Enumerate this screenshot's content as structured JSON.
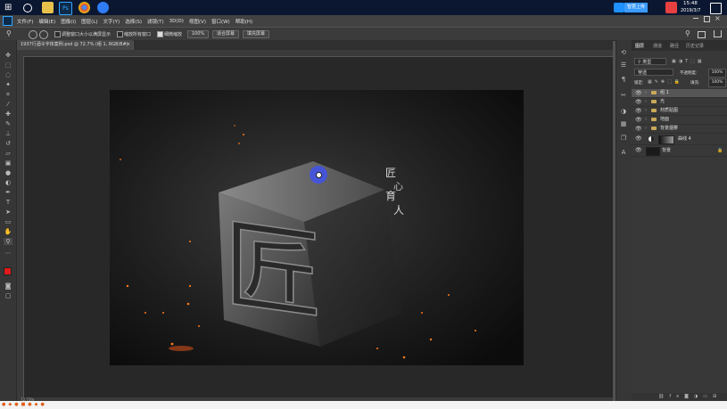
{
  "taskbar": {
    "time": "15:48",
    "date": "2019/3/7",
    "upload_label": "智慧上传"
  },
  "menu": [
    "文件(F)",
    "编辑(E)",
    "图像(I)",
    "图层(L)",
    "文字(Y)",
    "选择(S)",
    "滤镜(T)",
    "3D(D)",
    "视图(V)",
    "窗口(W)",
    "帮助(H)"
  ],
  "options": {
    "resize_windows": "调整窗口大小以满屏显示",
    "zoom_all": "缩放所有窗口",
    "scrubby_zoom": "细微缩放",
    "zoom_value": "100%",
    "fit_screen": "适合屏幕",
    "fill_screen": "填充屏幕"
  },
  "document": {
    "tab_title": "1937行酒令字体案例.psd @ 72.7% (组 1, RGB/8#)",
    "close": "×",
    "status_zoom": "72.73%"
  },
  "artwork": {
    "glyph": "匠",
    "vertical_text": [
      "匠",
      "心",
      "育",
      "人"
    ]
  },
  "panel": {
    "tabs": [
      "图层",
      "通道",
      "路径",
      "历史记录"
    ],
    "filter_kind": "类型",
    "blend_mode": "穿透",
    "opacity_label": "不透明度:",
    "opacity_value": "100%",
    "lock_label": "锁定:",
    "fill_label": "填充:",
    "fill_value": "100%",
    "layers": [
      {
        "name": "组 1",
        "type": "group"
      },
      {
        "name": "光",
        "type": "group"
      },
      {
        "name": "材质贴图",
        "type": "group"
      },
      {
        "name": "地面",
        "type": "group"
      },
      {
        "name": "背景烟雾",
        "type": "group"
      },
      {
        "name": "曲线 4",
        "type": "adjustment"
      },
      {
        "name": "背景",
        "type": "background"
      }
    ]
  },
  "colors": {
    "foreground": "#e01b1b",
    "background": "#ffffff",
    "selected_layer": "#565656"
  }
}
